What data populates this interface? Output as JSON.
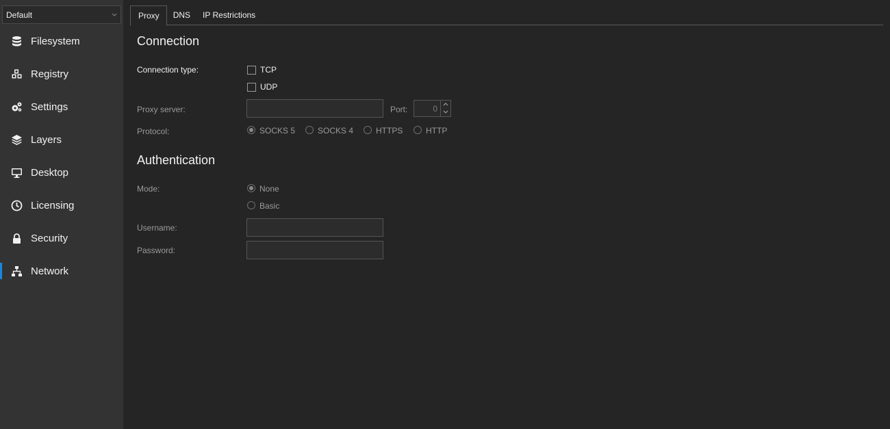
{
  "profile": {
    "selected": "Default"
  },
  "sidebar": {
    "items": [
      {
        "label": "Filesystem",
        "icon": "database-icon"
      },
      {
        "label": "Registry",
        "icon": "cubes-icon"
      },
      {
        "label": "Settings",
        "icon": "gears-icon"
      },
      {
        "label": "Layers",
        "icon": "layers-icon"
      },
      {
        "label": "Desktop",
        "icon": "monitor-icon"
      },
      {
        "label": "Licensing",
        "icon": "clock-icon"
      },
      {
        "label": "Security",
        "icon": "lock-icon"
      },
      {
        "label": "Network",
        "icon": "network-icon"
      }
    ],
    "active": "Network",
    "accent": "#1a86e0"
  },
  "tabs": {
    "proxy": "Proxy",
    "dns": "DNS",
    "ip": "IP Restrictions"
  },
  "connection": {
    "title": "Connection",
    "type_label": "Connection type:",
    "tcp": "TCP",
    "udp": "UDP",
    "proxy_label": "Proxy server:",
    "proxy_value": "",
    "port_label": "Port:",
    "port_value": "0",
    "protocol_label": "Protocol:",
    "protocols": [
      "SOCKS 5",
      "SOCKS 4",
      "HTTPS",
      "HTTP"
    ],
    "protocol_selected": "SOCKS 5"
  },
  "auth": {
    "title": "Authentication",
    "mode_label": "Mode:",
    "modes": [
      "None",
      "Basic"
    ],
    "mode_selected": "None",
    "username_label": "Username:",
    "password_label": "Password:"
  }
}
